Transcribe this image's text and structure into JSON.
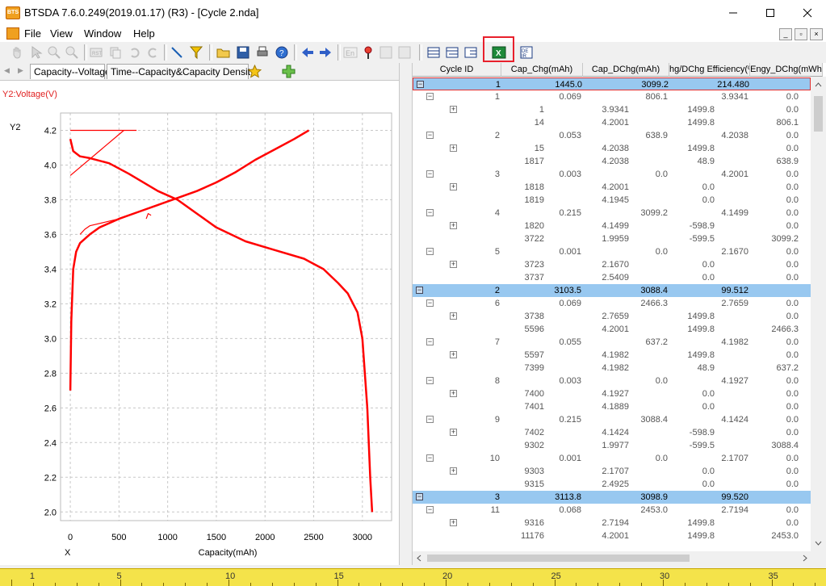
{
  "window": {
    "title": "BTSDA 7.6.0.249(2019.01.17) (R3) - [Cycle 2.nda]",
    "app_icon_text": "BTS"
  },
  "menu": {
    "file": "File",
    "view": "View",
    "window": "Window",
    "help": "Help"
  },
  "tabs": [
    {
      "label": "Capacity--Voltage"
    },
    {
      "label": "Time--Capacity&Capacity Density"
    }
  ],
  "chart": {
    "y2_series_label": "Y2:Voltage(V)",
    "y_axis_name": "Y2",
    "x_axis_name": "X",
    "xlabel": "Capacity(mAh)",
    "y_ticks": [
      "2.0",
      "2.2",
      "2.4",
      "2.6",
      "2.8",
      "3.0",
      "3.2",
      "3.4",
      "3.6",
      "3.8",
      "4.0",
      "4.2"
    ],
    "x_ticks": [
      "0",
      "500",
      "1000",
      "1500",
      "2000",
      "2500",
      "3000"
    ]
  },
  "chart_data": {
    "type": "line",
    "xlabel": "Capacity(mAh)",
    "ylabel": "Y2",
    "xlim": [
      -100,
      3300
    ],
    "ylim": [
      1.95,
      4.3
    ],
    "grid": true,
    "line_color": "#ff0000",
    "series": [
      {
        "x": [
          0,
          10,
          30,
          60,
          100,
          200,
          300,
          500,
          700,
          900,
          1100,
          1300,
          1500,
          1700,
          1900,
          2100,
          2300,
          2450
        ],
        "y": [
          2.7,
          3.1,
          3.4,
          3.5,
          3.55,
          3.6,
          3.64,
          3.69,
          3.73,
          3.77,
          3.81,
          3.85,
          3.9,
          3.96,
          4.03,
          4.09,
          4.15,
          4.2
        ]
      },
      {
        "x": [
          0,
          30,
          100,
          200,
          400,
          600,
          900,
          1100,
          1300,
          1500,
          1800,
          2100,
          2400,
          2600,
          2750,
          2850,
          2950,
          3000,
          3050,
          3080,
          3100
        ],
        "y": [
          4.15,
          4.08,
          4.05,
          4.04,
          4.01,
          3.95,
          3.85,
          3.8,
          3.72,
          3.64,
          3.56,
          3.51,
          3.46,
          3.4,
          3.32,
          3.26,
          3.15,
          3.0,
          2.6,
          2.2,
          2.0
        ]
      },
      {
        "x": [
          0,
          680
        ],
        "y": [
          4.2,
          4.2
        ]
      },
      {
        "x": [
          0,
          550
        ],
        "y": [
          3.94,
          4.2
        ]
      },
      {
        "x": [
          100,
          150,
          200,
          350,
          500
        ],
        "y": [
          3.6,
          3.63,
          3.65,
          3.67,
          3.69
        ]
      },
      {
        "x": [
          780,
          800,
          830
        ],
        "y": [
          3.69,
          3.72,
          3.71
        ]
      }
    ]
  },
  "grid": {
    "columns": [
      "Cycle ID",
      "Cap_Chg(mAh)",
      "Cap_DChg(mAh)",
      "hg/DChg Efficiency(%",
      "Engy_DChg(mWh"
    ],
    "rows": [
      {
        "level": 1,
        "cells": [
          "1",
          "1445.0",
          "3099.2",
          "214.480",
          "11"
        ],
        "selected": true
      },
      {
        "level": 2,
        "cells": [
          "1",
          "0.069",
          "806.1",
          "3.9341",
          "0.0"
        ]
      },
      {
        "level": 3,
        "cells": [
          "1",
          "3.9341",
          "1499.8",
          "0.0"
        ]
      },
      {
        "level": 3,
        "cells": [
          "14",
          "4.2001",
          "1499.8",
          "806.1"
        ]
      },
      {
        "level": 2,
        "cells": [
          "2",
          "0.053",
          "638.9",
          "4.2038",
          "0.0"
        ]
      },
      {
        "level": 3,
        "cells": [
          "15",
          "4.2038",
          "1499.8",
          "0.0"
        ]
      },
      {
        "level": 3,
        "cells": [
          "1817",
          "4.2038",
          "48.9",
          "638.9"
        ]
      },
      {
        "level": 2,
        "cells": [
          "3",
          "0.003",
          "0.0",
          "4.2001",
          "0.0"
        ]
      },
      {
        "level": 3,
        "cells": [
          "1818",
          "4.2001",
          "0.0",
          "0.0"
        ]
      },
      {
        "level": 3,
        "cells": [
          "1819",
          "4.1945",
          "0.0",
          "0.0"
        ]
      },
      {
        "level": 2,
        "cells": [
          "4",
          "0.215",
          "3099.2",
          "4.1499",
          "0.0"
        ]
      },
      {
        "level": 3,
        "cells": [
          "1820",
          "4.1499",
          "-598.9",
          "0.0"
        ]
      },
      {
        "level": 3,
        "cells": [
          "3722",
          "1.9959",
          "-599.5",
          "3099.2"
        ]
      },
      {
        "level": 2,
        "cells": [
          "5",
          "0.001",
          "0.0",
          "2.1670",
          "0.0"
        ]
      },
      {
        "level": 3,
        "cells": [
          "3723",
          "2.1670",
          "0.0",
          "0.0"
        ]
      },
      {
        "level": 3,
        "cells": [
          "3737",
          "2.5409",
          "0.0",
          "0.0"
        ]
      },
      {
        "level": 1,
        "cells": [
          "2",
          "3103.5",
          "3088.4",
          "99.512",
          "11"
        ]
      },
      {
        "level": 2,
        "cells": [
          "6",
          "0.069",
          "2466.3",
          "2.7659",
          "0.0"
        ]
      },
      {
        "level": 3,
        "cells": [
          "3738",
          "2.7659",
          "1499.8",
          "0.0"
        ]
      },
      {
        "level": 3,
        "cells": [
          "5596",
          "4.2001",
          "1499.8",
          "2466.3"
        ]
      },
      {
        "level": 2,
        "cells": [
          "7",
          "0.055",
          "637.2",
          "4.1982",
          "0.0"
        ]
      },
      {
        "level": 3,
        "cells": [
          "5597",
          "4.1982",
          "1499.8",
          "0.0"
        ]
      },
      {
        "level": 3,
        "cells": [
          "7399",
          "4.1982",
          "48.9",
          "637.2"
        ]
      },
      {
        "level": 2,
        "cells": [
          "8",
          "0.003",
          "0.0",
          "4.1927",
          "0.0"
        ]
      },
      {
        "level": 3,
        "cells": [
          "7400",
          "4.1927",
          "0.0",
          "0.0"
        ]
      },
      {
        "level": 3,
        "cells": [
          "7401",
          "4.1889",
          "0.0",
          "0.0"
        ]
      },
      {
        "level": 2,
        "cells": [
          "9",
          "0.215",
          "3088.4",
          "4.1424",
          "0.0"
        ]
      },
      {
        "level": 3,
        "cells": [
          "7402",
          "4.1424",
          "-598.9",
          "0.0"
        ]
      },
      {
        "level": 3,
        "cells": [
          "9302",
          "1.9977",
          "-599.5",
          "3088.4"
        ]
      },
      {
        "level": 2,
        "cells": [
          "10",
          "0.001",
          "0.0",
          "2.1707",
          "0.0"
        ]
      },
      {
        "level": 3,
        "cells": [
          "9303",
          "2.1707",
          "0.0",
          "0.0"
        ]
      },
      {
        "level": 3,
        "cells": [
          "9315",
          "2.4925",
          "0.0",
          "0.0"
        ]
      },
      {
        "level": 1,
        "cells": [
          "3",
          "3113.8",
          "3098.9",
          "99.520",
          "11"
        ]
      },
      {
        "level": 2,
        "cells": [
          "11",
          "0.068",
          "2453.0",
          "2.7194",
          "0.0"
        ]
      },
      {
        "level": 3,
        "cells": [
          "9316",
          "2.7194",
          "1499.8",
          "0.0"
        ]
      },
      {
        "level": 3,
        "cells": [
          "11176",
          "4.2001",
          "1499.8",
          "2453.0"
        ]
      }
    ]
  },
  "ruler": {
    "labels": [
      "1",
      "5",
      "10",
      "15",
      "20",
      "25",
      "30",
      "35"
    ]
  },
  "colors": {
    "accent_highlight": "#e8202c",
    "row_level1": "#98c8f0",
    "series": "#ff0000",
    "ruler": "#f4e34a"
  }
}
